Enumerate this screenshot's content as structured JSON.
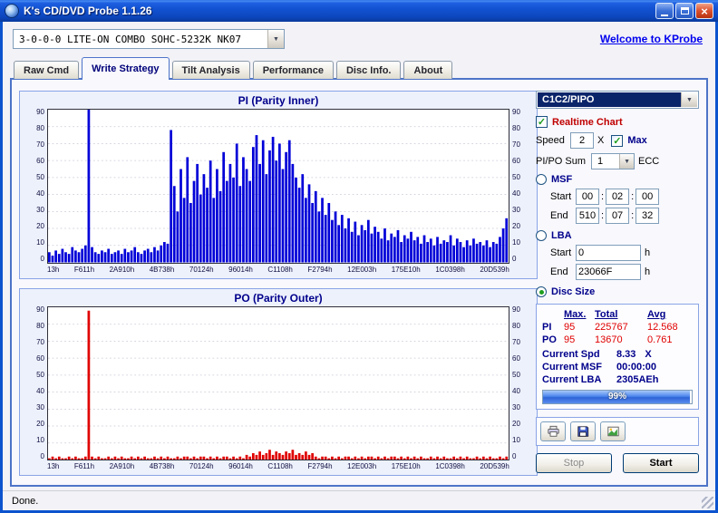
{
  "window": {
    "title": "K's CD/DVD Probe 1.1.26",
    "status": "Done."
  },
  "icons": {
    "dropdown": "▼",
    "check": "✓",
    "close": "×"
  },
  "toolbar": {
    "drive_combo": "3-0-0-0 LITE-ON COMBO SOHC-5232K NK07",
    "link": "Welcome to KProbe"
  },
  "tabs": [
    {
      "label": "Raw Cmd",
      "active": false
    },
    {
      "label": "Write Strategy",
      "active": true
    },
    {
      "label": "Tilt Analysis",
      "active": false
    },
    {
      "label": "Performance",
      "active": false
    },
    {
      "label": "Disc Info.",
      "active": false
    },
    {
      "label": "About",
      "active": false
    }
  ],
  "controls": {
    "mode_combo": "C1C2/PIPO",
    "realtime_chart_label": "Realtime Chart",
    "speed_label": "Speed",
    "speed_value": "2",
    "speed_unit": "X",
    "max_label": "Max",
    "pipo_sum_label": "PI/PO Sum",
    "pipo_sum_value": "1",
    "ecc_label": "ECC",
    "msf": {
      "label": "MSF",
      "start_label": "Start",
      "end_label": "End",
      "sep": ":",
      "start": [
        "00",
        "02",
        "00"
      ],
      "end": [
        "510",
        "07",
        "32"
      ]
    },
    "lba": {
      "label": "LBA",
      "start_label": "Start",
      "end_label": "End",
      "start": "0",
      "end": "23066F",
      "unit": "h"
    },
    "disc_size_label": "Disc Size"
  },
  "stats": {
    "headers": {
      "max": "Max.",
      "total": "Total",
      "avg": "Avg"
    },
    "rows": [
      {
        "name": "PI",
        "max": "95",
        "total": "225767",
        "avg": "12.568"
      },
      {
        "name": "PO",
        "max": "95",
        "total": "13670",
        "avg": "0.761"
      }
    ],
    "current_spd_label": "Current Spd",
    "current_spd": "8.33",
    "current_spd_unit": "X",
    "current_msf_label": "Current MSF",
    "current_msf": "00:00:00",
    "current_lba_label": "Current LBA",
    "current_lba": "2305AEh",
    "progress": "99%",
    "progress_pct": 99
  },
  "actions": {
    "stop": "Stop",
    "start": "Start"
  },
  "chart_data": [
    {
      "type": "bar",
      "title": "PI (Parity Inner)",
      "color": "#0000D8",
      "ylim": [
        0,
        90
      ],
      "yticks": [
        0,
        10,
        20,
        30,
        40,
        50,
        60,
        70,
        80,
        90
      ],
      "x_labels": [
        "13h",
        "F611h",
        "2A910h",
        "4B738h",
        "70124h",
        "96014h",
        "C1108h",
        "F2794h",
        "12E003h",
        "175E10h",
        "1C0398h",
        "20D539h"
      ],
      "values": [
        6,
        4,
        7,
        5,
        8,
        6,
        5,
        9,
        7,
        6,
        8,
        10,
        90,
        9,
        6,
        5,
        7,
        6,
        8,
        5,
        6,
        7,
        5,
        8,
        6,
        7,
        9,
        6,
        5,
        7,
        8,
        6,
        9,
        7,
        10,
        12,
        11,
        78,
        45,
        30,
        55,
        38,
        62,
        35,
        48,
        58,
        40,
        52,
        44,
        60,
        38,
        55,
        42,
        65,
        48,
        58,
        50,
        70,
        45,
        62,
        55,
        48,
        68,
        75,
        58,
        72,
        52,
        66,
        74,
        60,
        70,
        55,
        65,
        72,
        58,
        50,
        44,
        52,
        38,
        46,
        35,
        42,
        30,
        38,
        28,
        35,
        25,
        30,
        22,
        28,
        20,
        26,
        18,
        24,
        16,
        22,
        19,
        25,
        17,
        21,
        18,
        14,
        20,
        13,
        17,
        15,
        19,
        12,
        16,
        14,
        18,
        13,
        15,
        11,
        16,
        12,
        14,
        10,
        15,
        11,
        13,
        12,
        16,
        10,
        14,
        12,
        9,
        13,
        10,
        14,
        11,
        12,
        10,
        13,
        9,
        12,
        11,
        15,
        20,
        26
      ]
    },
    {
      "type": "bar",
      "title": "PO (Parity Outer)",
      "color": "#E00000",
      "ylim": [
        0,
        90
      ],
      "yticks": [
        0,
        10,
        20,
        30,
        40,
        50,
        60,
        70,
        80,
        90
      ],
      "x_labels": [
        "13h",
        "F611h",
        "2A910h",
        "4B738h",
        "70124h",
        "96014h",
        "C1108h",
        "F2794h",
        "12E003h",
        "175E10h",
        "1C0398h",
        "20D539h"
      ],
      "values": [
        1,
        2,
        1,
        2,
        1,
        1,
        2,
        1,
        2,
        1,
        1,
        2,
        88,
        2,
        1,
        2,
        1,
        1,
        2,
        1,
        2,
        1,
        2,
        1,
        1,
        2,
        1,
        2,
        1,
        2,
        1,
        1,
        2,
        1,
        2,
        1,
        2,
        1,
        1,
        2,
        1,
        2,
        2,
        1,
        2,
        1,
        2,
        2,
        1,
        2,
        1,
        2,
        1,
        2,
        2,
        1,
        2,
        1,
        2,
        1,
        3,
        2,
        4,
        3,
        5,
        3,
        4,
        6,
        3,
        5,
        4,
        3,
        5,
        4,
        6,
        3,
        4,
        3,
        5,
        3,
        4,
        2,
        1,
        2,
        2,
        1,
        2,
        1,
        2,
        1,
        2,
        2,
        1,
        2,
        1,
        2,
        1,
        2,
        2,
        1,
        2,
        1,
        2,
        1,
        2,
        2,
        1,
        2,
        1,
        2,
        1,
        2,
        1,
        2,
        1,
        1,
        2,
        1,
        2,
        1,
        2,
        1,
        1,
        2,
        1,
        2,
        1,
        2,
        1,
        1,
        2,
        1,
        2,
        1,
        2,
        1,
        1,
        2,
        1,
        2
      ]
    }
  ]
}
